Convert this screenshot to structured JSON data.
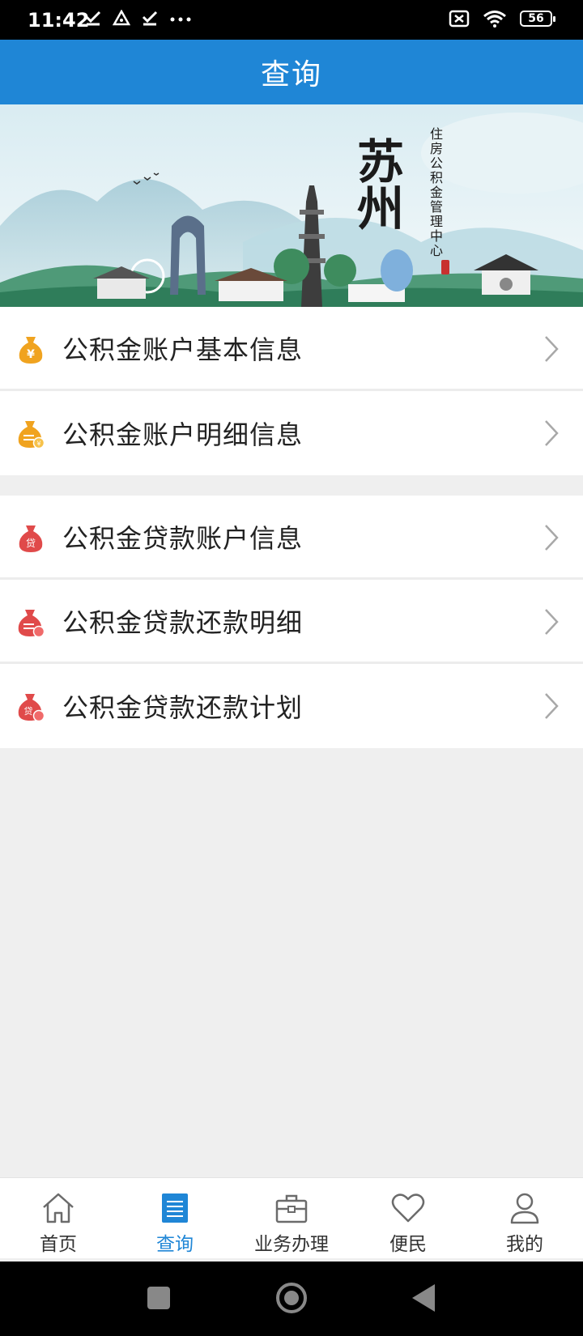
{
  "status_bar": {
    "time": "11:42",
    "battery": "56"
  },
  "header": {
    "title": "查询"
  },
  "banner": {
    "city": "苏州",
    "subtitle": "住房公积金管理中心"
  },
  "colors": {
    "primary": "#1f86d6",
    "coin_orange": "#f0a31f",
    "loan_red": "#e04a4a"
  },
  "menu": {
    "group1": [
      {
        "label": "公积金账户基本信息",
        "icon": "money-bag-yen-icon"
      },
      {
        "label": "公积金账户明细信息",
        "icon": "money-bag-detail-icon"
      }
    ],
    "group2": [
      {
        "label": "公积金贷款账户信息",
        "icon": "loan-bag-icon"
      },
      {
        "label": "公积金贷款还款明细",
        "icon": "loan-repay-detail-icon"
      },
      {
        "label": "公积金贷款还款计划",
        "icon": "loan-repay-plan-icon"
      }
    ]
  },
  "bottom_nav": {
    "items": [
      {
        "label": "首页",
        "icon": "home-icon"
      },
      {
        "label": "查询",
        "icon": "query-list-icon",
        "active": true
      },
      {
        "label": "业务办理",
        "icon": "briefcase-icon"
      },
      {
        "label": "便民",
        "icon": "heart-icon"
      },
      {
        "label": "我的",
        "icon": "user-icon"
      }
    ]
  }
}
